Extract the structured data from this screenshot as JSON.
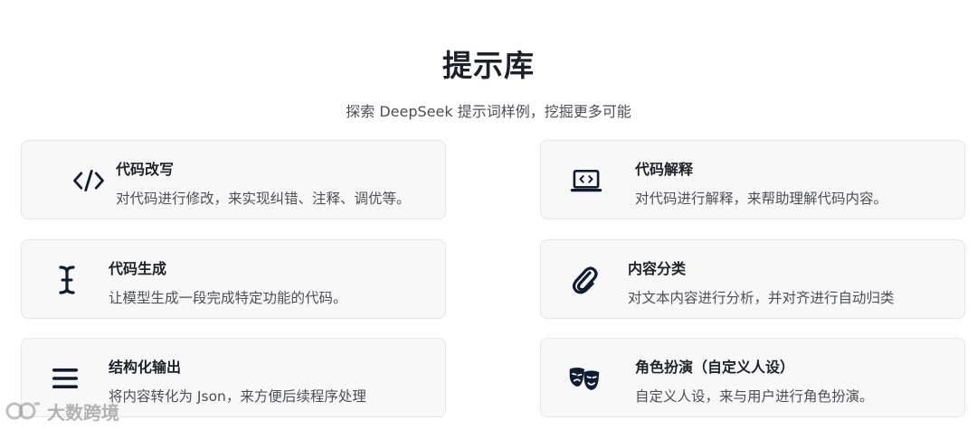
{
  "header": {
    "title": "提示库",
    "subtitle": "探索 DeepSeek 提示词样例，挖掘更多可能"
  },
  "cards": [
    {
      "title": "代码改写",
      "desc": "对代码进行修改，来实现纠错、注释、调优等。",
      "icon": "code-icon"
    },
    {
      "title": "代码解释",
      "desc": "对代码进行解释，来帮助理解代码内容。",
      "icon": "laptop-code-icon"
    },
    {
      "title": "代码生成",
      "desc": "让模型生成一段完成特定功能的代码。",
      "icon": "text-cursor-icon"
    },
    {
      "title": "内容分类",
      "desc": "对文本内容进行分析，并对齐进行自动归类",
      "icon": "paperclip-icon"
    },
    {
      "title": "结构化输出",
      "desc": "将内容转化为 Json，来方便后续程序处理",
      "icon": "menu-lines-icon"
    },
    {
      "title": "角色扮演（自定义人设）",
      "desc": "自定义人设，来与用户进行角色扮演。",
      "icon": "theater-masks-icon"
    }
  ],
  "watermark": {
    "text": "大数跨境"
  },
  "colors": {
    "icon": "#0f1d33",
    "card_bg": "#f8f8f9",
    "card_border": "#e6e6e8"
  }
}
